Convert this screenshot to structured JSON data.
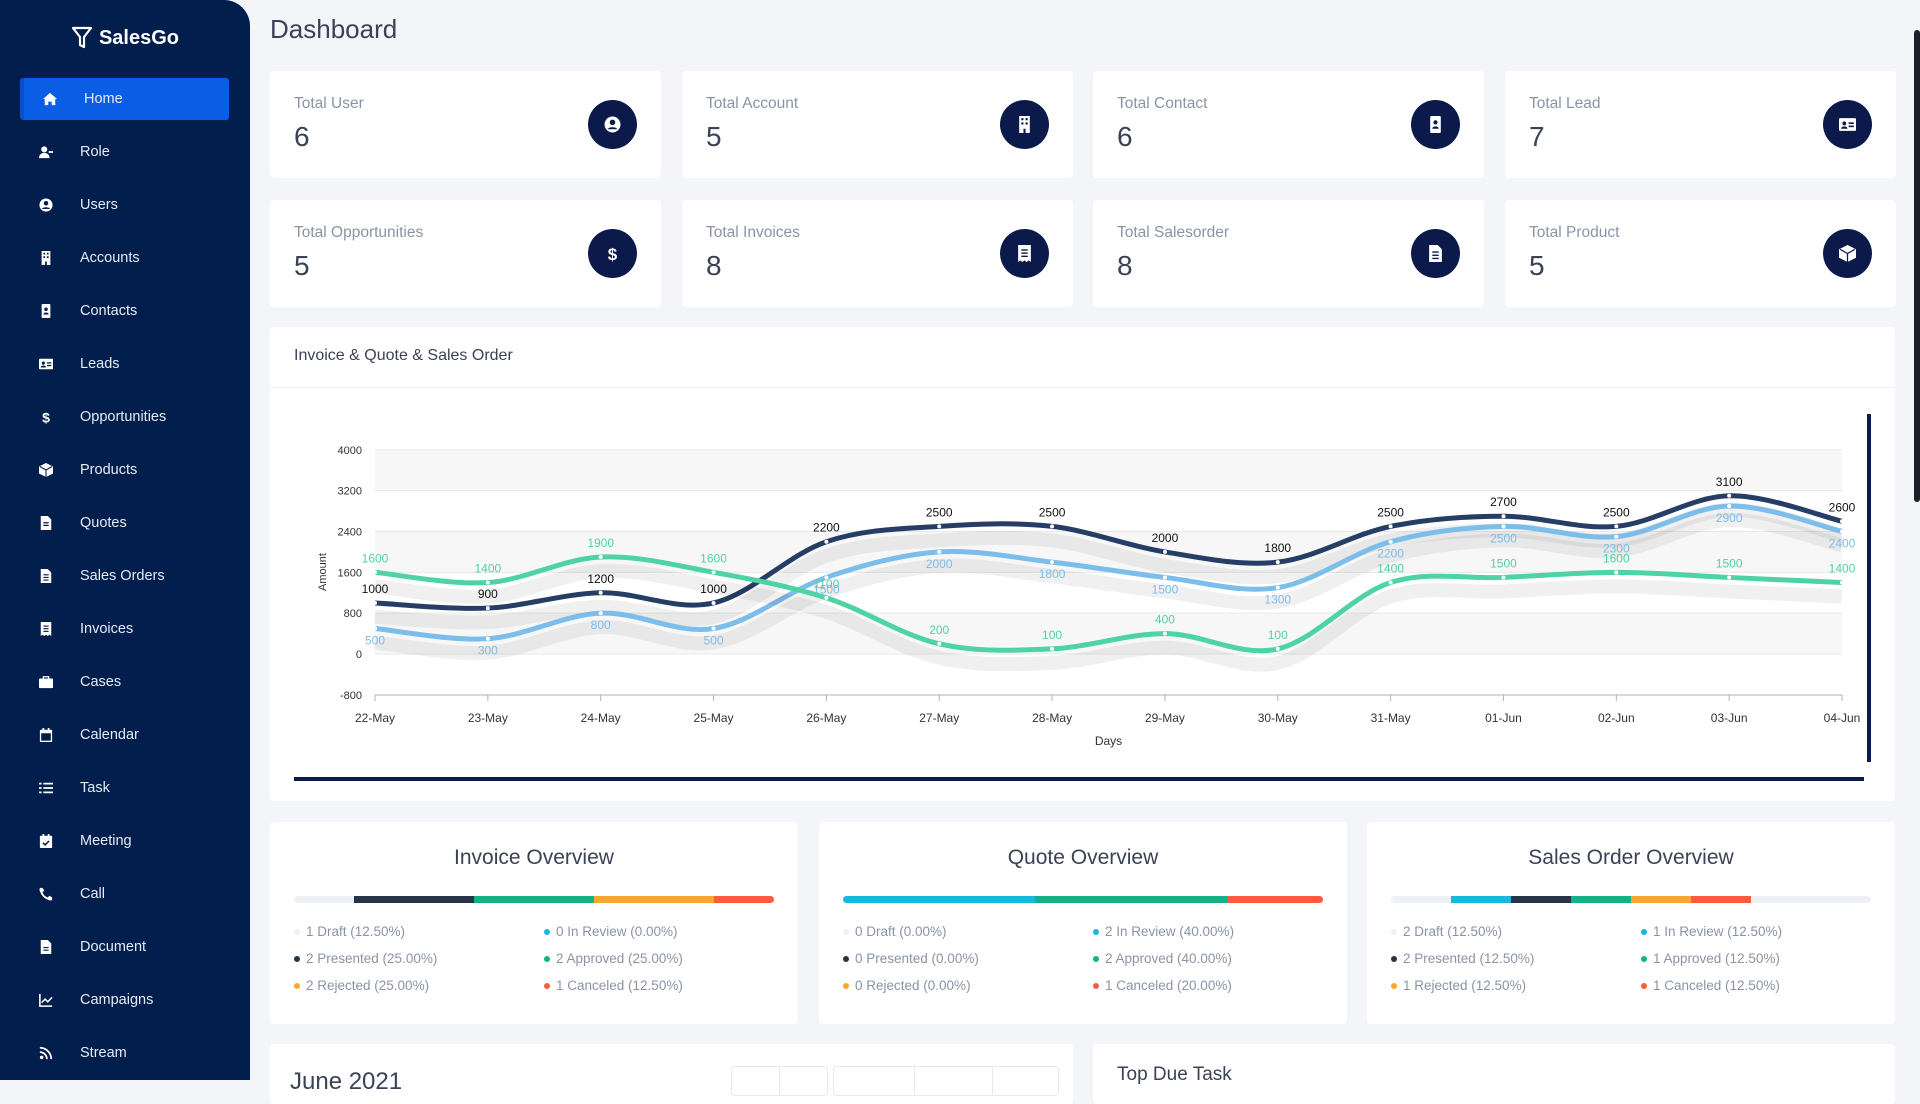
{
  "app": {
    "name": "SalesGo"
  },
  "sidebar": {
    "items": [
      {
        "label": "Home",
        "icon": "home-icon",
        "active": true
      },
      {
        "label": "Role",
        "icon": "user-role-icon"
      },
      {
        "label": "Users",
        "icon": "user-circle-icon"
      },
      {
        "label": "Accounts",
        "icon": "building-icon"
      },
      {
        "label": "Contacts",
        "icon": "contact-book-icon"
      },
      {
        "label": "Leads",
        "icon": "id-card-icon"
      },
      {
        "label": "Opportunities",
        "icon": "dollar-icon"
      },
      {
        "label": "Products",
        "icon": "box-icon"
      },
      {
        "label": "Quotes",
        "icon": "file-icon"
      },
      {
        "label": "Sales Orders",
        "icon": "file-alt-icon"
      },
      {
        "label": "Invoices",
        "icon": "receipt-icon"
      },
      {
        "label": "Cases",
        "icon": "briefcase-icon"
      },
      {
        "label": "Calendar",
        "icon": "calendar-icon"
      },
      {
        "label": "Task",
        "icon": "tasks-icon"
      },
      {
        "label": "Meeting",
        "icon": "calendar-check-icon"
      },
      {
        "label": "Call",
        "icon": "phone-icon"
      },
      {
        "label": "Document",
        "icon": "document-icon"
      },
      {
        "label": "Campaigns",
        "icon": "chart-line-icon"
      },
      {
        "label": "Stream",
        "icon": "rss-icon"
      }
    ]
  },
  "header": {
    "title": "Dashboard"
  },
  "stats": [
    {
      "label": "Total User",
      "value": "6",
      "icon": "user-circle-icon"
    },
    {
      "label": "Total Account",
      "value": "5",
      "icon": "building-icon"
    },
    {
      "label": "Total Contact",
      "value": "6",
      "icon": "contact-book-icon"
    },
    {
      "label": "Total Lead",
      "value": "7",
      "icon": "id-card-icon"
    },
    {
      "label": "Total Opportunities",
      "value": "5",
      "icon": "dollar-icon"
    },
    {
      "label": "Total Invoices",
      "value": "8",
      "icon": "receipt-icon"
    },
    {
      "label": "Total Salesorder",
      "value": "8",
      "icon": "file-alt-icon"
    },
    {
      "label": "Total Product",
      "value": "5",
      "icon": "box-icon"
    }
  ],
  "chart_data": {
    "type": "line",
    "title": "Invoice & Quote & Sales Order",
    "xlabel": "Days",
    "ylabel": "Amount",
    "ylim": [
      -800,
      4000
    ],
    "yticks": [
      "4000",
      "3200",
      "2400",
      "1600",
      "800",
      "0",
      "-800"
    ],
    "categories": [
      "22-May",
      "23-May",
      "24-May",
      "25-May",
      "26-May",
      "27-May",
      "28-May",
      "29-May",
      "30-May",
      "31-May",
      "01-Jun",
      "02-Jun",
      "03-Jun",
      "04-Jun"
    ],
    "grid": true,
    "series": [
      {
        "color": "#263e66",
        "values": [
          1000,
          900,
          1200,
          1000,
          2200,
          2500,
          2500,
          2000,
          1800,
          2500,
          2700,
          2500,
          3100,
          2600
        ]
      },
      {
        "color": "#7dbde9",
        "values": [
          500,
          300,
          800,
          500,
          1500,
          2000,
          1800,
          1500,
          1300,
          2200,
          2500,
          2300,
          2900,
          2400
        ]
      },
      {
        "color": "#4dd3a4",
        "values": [
          1600,
          1400,
          1900,
          1600,
          1100,
          200,
          100,
          400,
          100,
          1400,
          1500,
          1600,
          1500,
          1400
        ]
      }
    ]
  },
  "status_colors": {
    "Draft": "#eef1f6",
    "In Review": "#17b8e0",
    "Presented": "#263448",
    "Approved": "#10b386",
    "Rejected": "#fba72d",
    "Canceled": "#ff5a3c"
  },
  "overviews": [
    {
      "title": "Invoice Overview",
      "items": [
        {
          "status": "Draft",
          "text": "1 Draft (12.50%)",
          "pct": 12.5
        },
        {
          "status": "In Review",
          "text": "0 In Review (0.00%)",
          "pct": 0
        },
        {
          "status": "Presented",
          "text": "2 Presented (25.00%)",
          "pct": 25
        },
        {
          "status": "Approved",
          "text": "2 Approved (25.00%)",
          "pct": 25
        },
        {
          "status": "Rejected",
          "text": "2 Rejected (25.00%)",
          "pct": 25
        },
        {
          "status": "Canceled",
          "text": "1 Canceled (12.50%)",
          "pct": 12.5
        }
      ]
    },
    {
      "title": "Quote Overview",
      "items": [
        {
          "status": "Draft",
          "text": "0 Draft (0.00%)",
          "pct": 0
        },
        {
          "status": "In Review",
          "text": "2 In Review (40.00%)",
          "pct": 40
        },
        {
          "status": "Presented",
          "text": "0 Presented (0.00%)",
          "pct": 0
        },
        {
          "status": "Approved",
          "text": "2 Approved (40.00%)",
          "pct": 40
        },
        {
          "status": "Rejected",
          "text": "0 Rejected (0.00%)",
          "pct": 0
        },
        {
          "status": "Canceled",
          "text": "1 Canceled (20.00%)",
          "pct": 20
        }
      ]
    },
    {
      "title": "Sales Order Overview",
      "items": [
        {
          "status": "Draft",
          "text": "2 Draft (12.50%)",
          "pct": 12.5
        },
        {
          "status": "In Review",
          "text": "1 In Review (12.50%)",
          "pct": 12.5
        },
        {
          "status": "Presented",
          "text": "2 Presented (12.50%)",
          "pct": 12.5
        },
        {
          "status": "Approved",
          "text": "1 Approved (12.50%)",
          "pct": 12.5
        },
        {
          "status": "Rejected",
          "text": "1 Rejected (12.50%)",
          "pct": 12.5
        },
        {
          "status": "Canceled",
          "text": "1 Canceled (12.50%)",
          "pct": 12.5
        }
      ]
    }
  ],
  "calendar": {
    "title": "June 2021"
  },
  "tasks": {
    "title": "Top Due Task"
  }
}
